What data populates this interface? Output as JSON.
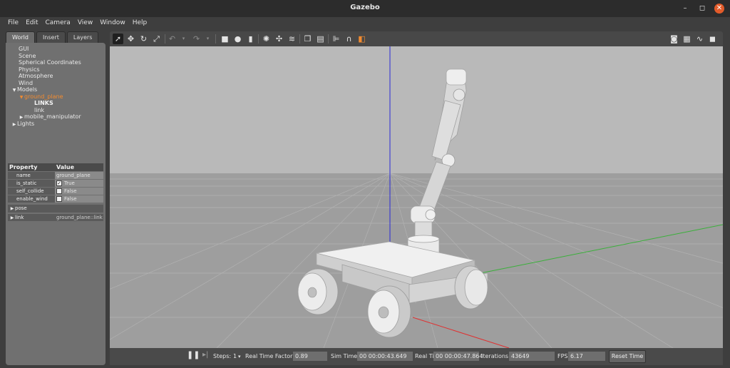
{
  "window": {
    "title": "Gazebo",
    "minimize": "–",
    "maximize": "◻",
    "close": "✕"
  },
  "menu": [
    "File",
    "Edit",
    "Camera",
    "View",
    "Window",
    "Help"
  ],
  "tabs": [
    "World",
    "Insert",
    "Layers"
  ],
  "tree": {
    "gui": "GUI",
    "scene": "Scene",
    "spherical": "Spherical Coordinates",
    "physics": "Physics",
    "atmosphere": "Atmosphere",
    "wind": "Wind",
    "models": "Models",
    "ground_plane": "ground_plane",
    "links": "LINKS",
    "link": "link",
    "mobile_manipulator": "mobile_manipulator",
    "lights": "Lights"
  },
  "properties": {
    "header_key": "Property",
    "header_value": "Value",
    "rows": [
      {
        "key": "name",
        "value": "ground_plane"
      },
      {
        "key": "is_static",
        "value": "True",
        "checked": true
      },
      {
        "key": "self_collide",
        "value": "False",
        "checked": false
      },
      {
        "key": "enable_wind",
        "value": "False",
        "checked": false
      }
    ],
    "pose": "pose",
    "link_key": "link",
    "link_value": "ground_plane::link"
  },
  "toolbar": {
    "tools": [
      "select-mode",
      "translate-mode",
      "rotate-mode",
      "scale-mode",
      "undo",
      "redo",
      "box",
      "sphere",
      "cylinder",
      "point-light",
      "spot-light",
      "directional-light",
      "copy",
      "paste",
      "align",
      "snap",
      "change-view"
    ],
    "right": [
      "screenshot",
      "log",
      "plot",
      "video"
    ]
  },
  "status": {
    "steps_label": "Steps:",
    "steps_value": "1",
    "rtf_label": "Real Time Factor:",
    "rtf_value": "0.89",
    "sim_label": "Sim Time:",
    "sim_value": "00 00:00:43.649",
    "real_label": "Real Time:",
    "real_value": "00 00:00:47.864",
    "iter_label": "Iterations:",
    "iter_value": "43649",
    "fps_label": "FPS:",
    "fps_value": "6.17",
    "reset_label": "Reset Time"
  },
  "colors": {
    "selected": "#f28b30",
    "sky": "#b9b9b9",
    "ground": "#9e9e9e",
    "x_axis": "#e03030",
    "y_axis": "#3ab03a",
    "z_axis": "#2a2ad8"
  }
}
